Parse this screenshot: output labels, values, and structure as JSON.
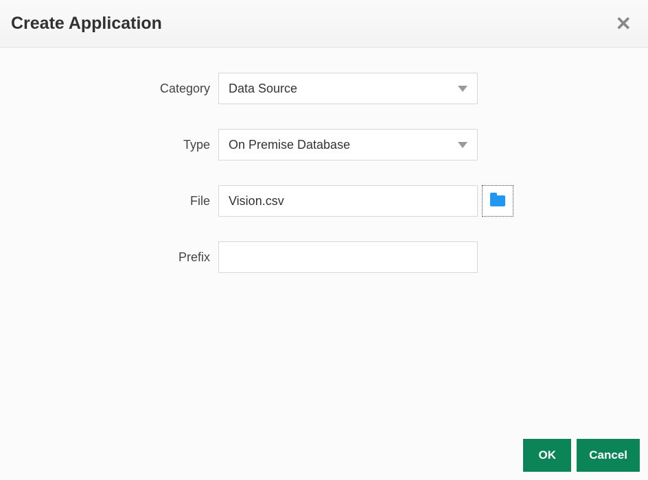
{
  "dialog": {
    "title": "Create Application"
  },
  "form": {
    "category": {
      "label": "Category",
      "value": "Data Source"
    },
    "type": {
      "label": "Type",
      "value": "On Premise Database"
    },
    "file": {
      "label": "File",
      "value": "Vision.csv"
    },
    "prefix": {
      "label": "Prefix",
      "value": ""
    }
  },
  "buttons": {
    "ok": "OK",
    "cancel": "Cancel"
  }
}
